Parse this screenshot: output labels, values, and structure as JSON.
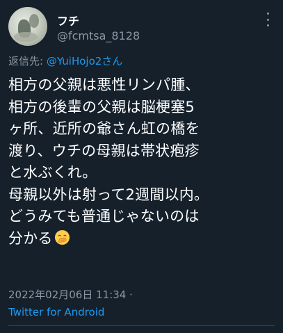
{
  "user": {
    "display_name": "フチ",
    "handle": "@fcmtsa_8128"
  },
  "reply": {
    "prefix": "返信先: ",
    "mention": "@YuiHojo2さん"
  },
  "tweet": {
    "lines": [
      "相方の父親は悪性リンパ腫、",
      "相方の後輩の父親は脳梗塞5",
      "ヶ所、近所の爺さん虹の橋を",
      "渡り、ウチの母親は帯状疱疹",
      "と水ぶくれ。",
      "母親以外は射って2週間以内。",
      "どうみても普通じゃないのは",
      "分かる"
    ],
    "trailing_emoji": "hand-over-mouth-emoji"
  },
  "meta": {
    "timestamp": "2022年02月06日 11:34 ·",
    "source": "Twitter for Android"
  },
  "colors": {
    "background": "#15202b",
    "text": "#ffffff",
    "secondary": "#8b98a5",
    "accent": "#1d9bf0"
  }
}
